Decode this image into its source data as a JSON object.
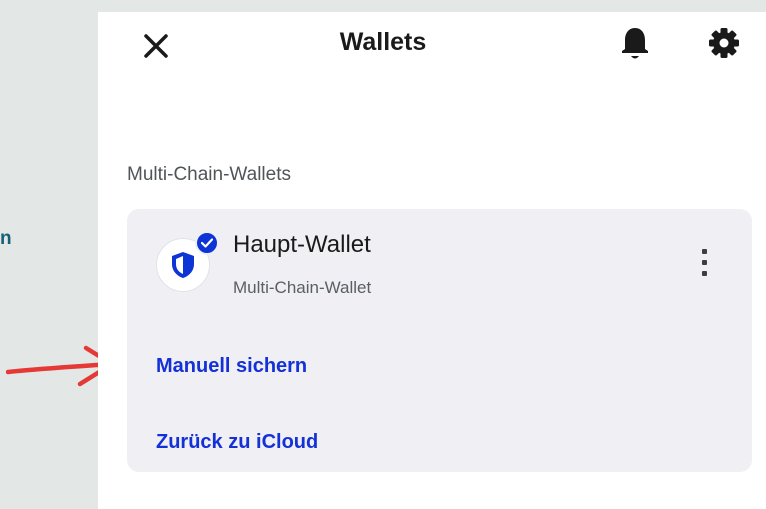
{
  "left_edge": {
    "text": "n"
  },
  "header": {
    "title": "Wallets",
    "close_icon": "close-icon",
    "notification_icon": "bell-icon",
    "settings_icon": "gear-icon"
  },
  "section": {
    "label": "Multi-Chain-Wallets"
  },
  "wallet": {
    "name": "Haupt-Wallet",
    "type": "Multi-Chain-Wallet",
    "avatar_icon": "shield-icon",
    "badge_icon": "check-icon",
    "menu_icon": "more-vertical-icon"
  },
  "actions": {
    "manual_backup": "Manuell sichern",
    "icloud_backup": "Zurück zu iCloud"
  },
  "colors": {
    "link": "#1431d8",
    "brand_blue": "#0d35d6",
    "annotation_arrow": "#e53935",
    "edge_text": "#17607a"
  }
}
